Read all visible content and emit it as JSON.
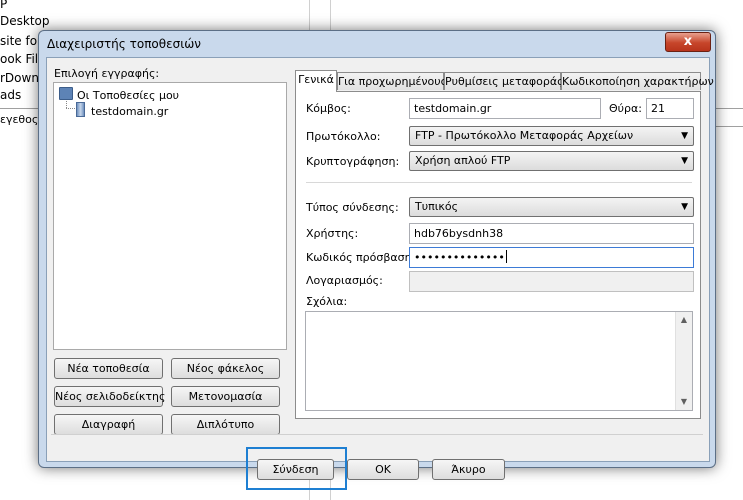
{
  "background": {
    "items": [
      "P",
      " Desktop",
      "site fo",
      "ook File",
      "rDownl",
      "ads",
      "εγεθος α"
    ]
  },
  "dialog": {
    "title": "Διαχειριστής τοποθεσιών",
    "close_symbol": "x",
    "left": {
      "label": "Επιλογή εγγραφής:",
      "tree": {
        "root": "Οι Τοποθεσίες μου",
        "child": "testdomain.gr"
      },
      "buttons": {
        "new_site": "Νέα τοποθεσία",
        "new_folder": "Νέος φάκελος",
        "new_bookmark": "Νέος σελιδοδείκτης",
        "rename": "Μετονομασία",
        "delete": "Διαγραφή",
        "duplicate": "Διπλότυπο"
      }
    },
    "tabs": [
      "Γενικά",
      "Για προχωρημένους",
      "Ρυθμίσεις μεταφοράς",
      "Κωδικοποίηση χαρακτήρων"
    ],
    "general": {
      "host_label": "Κόμβος:",
      "host_value": "testdomain.gr",
      "port_label": "Θύρα:",
      "port_value": "21",
      "protocol_label": "Πρωτόκολλο:",
      "protocol_value": "FTP - Πρωτόκολλο Μεταφοράς Αρχείων",
      "encryption_label": "Κρυπτογράφηση:",
      "encryption_value": "Χρήση απλού FTP",
      "logon_label": "Τύπος σύνδεσης:",
      "logon_value": "Τυπικός",
      "user_label": "Χρήστης:",
      "user_value": "hdb76bysdnh38",
      "password_label": "Κωδικός πρόσβασης:",
      "password_value": "••••••••••••••",
      "account_label": "Λογαριασμός:",
      "account_value": "",
      "comments_label": "Σχόλια:"
    },
    "buttons": {
      "connect": "Σύνδεση",
      "ok": "OK",
      "cancel": "Άκυρο"
    }
  },
  "colors": {
    "accent_highlight": "#1e7fd2",
    "dialog_frame": "#c9d9ec",
    "close_button": "#c7452a"
  }
}
